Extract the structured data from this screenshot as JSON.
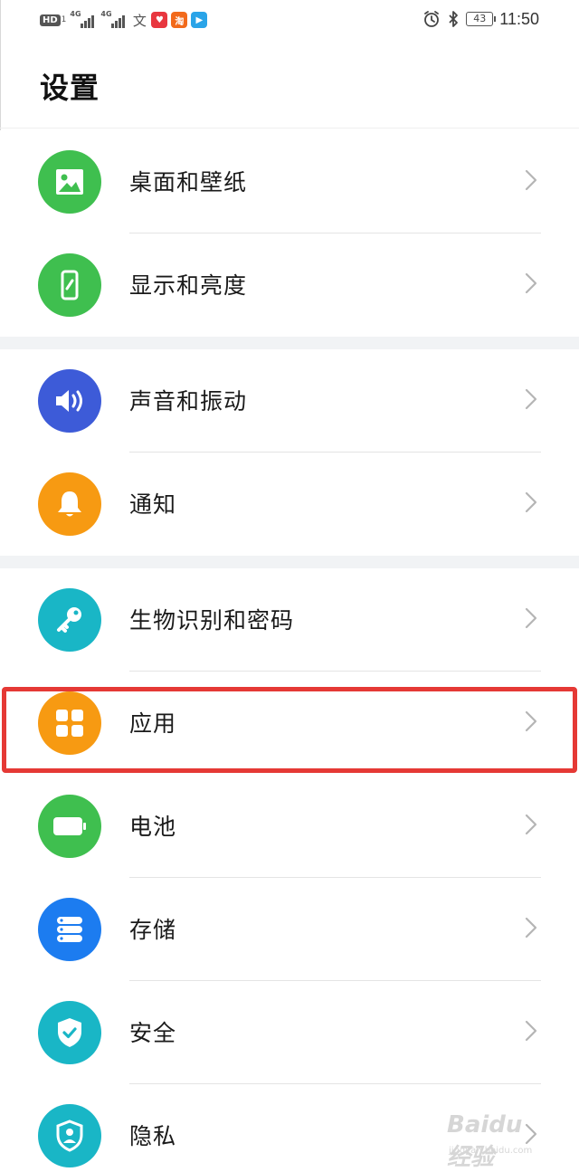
{
  "status_bar": {
    "hd_label": "HD",
    "hd_sub": "1",
    "signal_1_label": "4G",
    "signal_2_label": "4G",
    "wen_glyph": "文",
    "app_icons": [
      "alipay-red-icon",
      "taobao-icon",
      "delivery-icon"
    ],
    "battery": "43",
    "time": "11:50"
  },
  "page": {
    "title": "设置"
  },
  "groups": [
    {
      "items": [
        {
          "label": "桌面和壁纸",
          "icon": "wallpaper-icon",
          "color": "#3fbf4f"
        },
        {
          "label": "显示和亮度",
          "icon": "display-icon",
          "color": "#3fbf4f"
        }
      ]
    },
    {
      "items": [
        {
          "label": "声音和振动",
          "icon": "sound-icon",
          "color": "#3d5bd8"
        },
        {
          "label": "通知",
          "icon": "bell-icon",
          "color": "#f79a12"
        }
      ]
    },
    {
      "items": [
        {
          "label": "生物识别和密码",
          "icon": "key-icon",
          "color": "#19b6c6"
        },
        {
          "label": "应用",
          "icon": "apps-icon",
          "color": "#f79a12"
        },
        {
          "label": "电池",
          "icon": "battery-icon",
          "color": "#3fbf4f"
        },
        {
          "label": "存储",
          "icon": "storage-icon",
          "color": "#1c7cf0"
        },
        {
          "label": "安全",
          "icon": "shield-check-icon",
          "color": "#19b6c6"
        },
        {
          "label": "隐私",
          "icon": "privacy-icon",
          "color": "#19b6c6"
        }
      ]
    }
  ],
  "watermark": {
    "brand": "Baidu 经验",
    "url": "jingyan.baidu.com"
  }
}
